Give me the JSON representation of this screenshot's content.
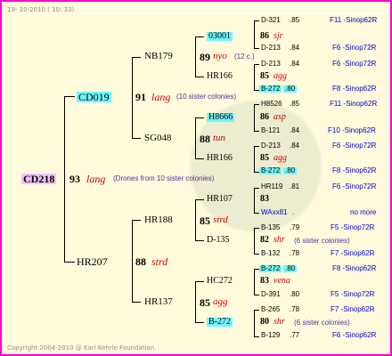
{
  "date": "19- 10-2010 ( 10: 33)",
  "copyright": "Copyright 2004-2010 @ Karl Kehrle Foundation.",
  "root": {
    "id": "CD218",
    "generation_number": "93",
    "breed": "lang",
    "note": "(Drones from 10 sister colonies)"
  },
  "gen1": {
    "top": {
      "id": "CD019",
      "number": "91",
      "breed": "lang",
      "note": "(10 sister colonies)"
    },
    "bottom": {
      "id": "HR207",
      "number": "88",
      "breed": "strd"
    }
  },
  "gen2": {
    "nb179": {
      "id": "NB179",
      "number": "89",
      "breed": "nyo",
      "note": "(12 c.)"
    },
    "sg048": {
      "id": "SG048",
      "number": "88",
      "breed": "tun"
    },
    "hr188": {
      "id": "HR188",
      "number": "85",
      "breed": "strd"
    },
    "hr137": {
      "id": "HR137",
      "number": "85",
      "breed": "agg"
    }
  },
  "gen3": [
    {
      "label": "03001",
      "boxed": true,
      "num": "86",
      "breed": "sjr"
    },
    {
      "label": "HR166",
      "boxed": false,
      "num": "85",
      "breed": "agg"
    },
    {
      "label": "H8666",
      "boxed": true,
      "num": "86",
      "breed": "asp"
    },
    {
      "label": "HR166",
      "boxed": false,
      "num": "85",
      "breed": "agg"
    },
    {
      "label": "HR107",
      "boxed": false,
      "num": "83",
      "breed": ""
    },
    {
      "label": "D-135",
      "boxed": false,
      "num": "82",
      "breed": "shr",
      "note": "(6 sister colonies)"
    },
    {
      "label": "HC272",
      "boxed": false,
      "num": "83",
      "breed": "vena"
    },
    {
      "label": "B-272",
      "boxed": true,
      "num": "80",
      "breed": "shr",
      "note": "(6 sister colonies)"
    }
  ],
  "gen4": [
    {
      "id": "D-321",
      "val": ".85",
      "ref": "F11 -Sinop62R"
    },
    {
      "id": "D-213",
      "val": ".84",
      "ref": "F6 -Sinop72R"
    },
    {
      "id": "D-213",
      "val": ".84",
      "ref": "F6 -Sinop72R"
    },
    {
      "id": "B-272",
      "val": ".80",
      "ref": "F8 -Sinop62R",
      "boxed": true
    },
    {
      "id": "H8526",
      "val": ".85",
      "ref": "F11 -Sinop62R"
    },
    {
      "id": "B-121",
      "val": ".84",
      "ref": "F10 -Sinop62R"
    },
    {
      "id": "D-213",
      "val": ".84",
      "ref": "F6 -Sinop72R"
    },
    {
      "id": "B-272",
      "val": ".80",
      "ref": "F8 -Sinop62R",
      "boxed": true
    },
    {
      "id": "HR119",
      "val": ".81",
      "ref": "F6 -Sinop72R"
    },
    {
      "id": "WAxx81",
      "val": ".",
      "ref": "no more",
      "blue": true
    },
    {
      "id": "B-135",
      "val": ".79",
      "ref": "F5 -Sinop72R"
    },
    {
      "id": "B-132",
      "val": ".78",
      "ref": "F7 -Sinop62R"
    },
    {
      "id": "B-272",
      "val": ".80",
      "ref": "F8 -Sinop62R",
      "boxed": true
    },
    {
      "id": "D-391",
      "val": ".80",
      "ref": "F5 -Sinop72R"
    },
    {
      "id": "B-265",
      "val": ".78",
      "ref": "F7 -Sinop62R"
    },
    {
      "id": "B-129",
      "val": ".77",
      "ref": "F6 -Sinop62R"
    }
  ]
}
